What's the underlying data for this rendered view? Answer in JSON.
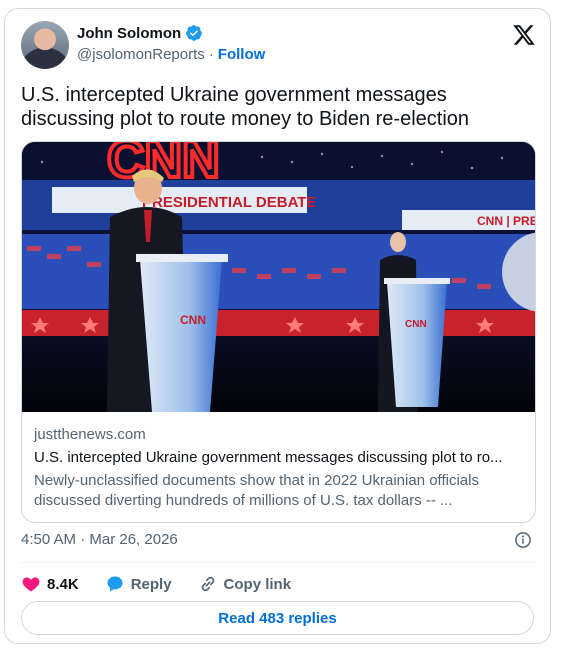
{
  "author": {
    "name": "John Solomon",
    "handle": "@jsolomonReports",
    "separator": "·",
    "follow_label": "Follow"
  },
  "tweet": {
    "text": "U.S. intercepted Ukraine government messages discussing plot to route money to Biden re-election"
  },
  "link_card": {
    "domain": "justthenews.com",
    "title": "U.S. intercepted Ukraine government messages discussing plot to ro...",
    "description": "Newly-unclassified documents show that in 2022 Ukrainian officials discussed diverting hundreds of millions of U.S. tax dollars -- ...",
    "image_texts": {
      "logo_top": "CNN",
      "banner_left": "PRESIDENTIAL DEBATE",
      "banner_right": "CNN | PRES",
      "podium_left": "CNN",
      "podium_right": "CNN"
    }
  },
  "meta": {
    "timestamp": "4:50 AM · Mar 26, 2026"
  },
  "actions": {
    "likes": "8.4K",
    "reply_label": "Reply",
    "copy_link_label": "Copy link"
  },
  "read_replies_label": "Read 483 replies",
  "colors": {
    "accent": "#006fd6",
    "like": "#f91880",
    "reply": "#1d9bf0",
    "muted": "#536471",
    "border": "#cfd9de"
  }
}
